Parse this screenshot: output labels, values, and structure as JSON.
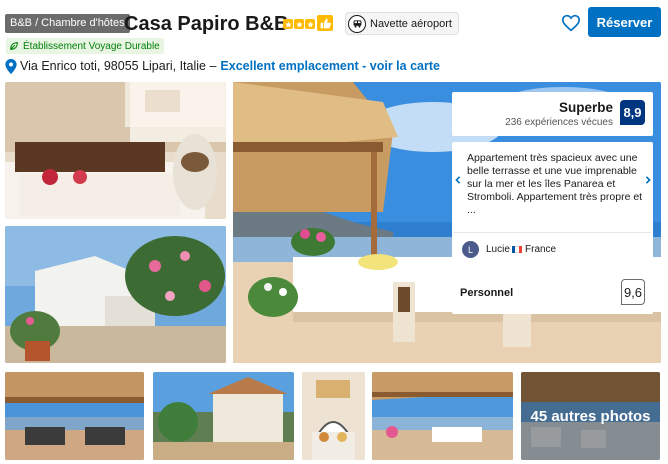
{
  "header": {
    "property_type": "B&B / Chambre d'hôtes",
    "title": "Casa Papiro B&B",
    "stars": 3,
    "shuttle_label": "Navette aéroport",
    "reserve_label": "Réserver"
  },
  "eco_label": "Établissement Voyage Durable",
  "address": {
    "text": "Via Enrico toti, 98055 Lipari, Italie –",
    "map_link": "Excellent emplacement - voir la carte"
  },
  "score": {
    "label": "Superbe",
    "count": "236 expériences vécues",
    "value": "8,9"
  },
  "review": {
    "text": "Appartement très spacieux avec une belle terrasse et une vue imprenable sur la mer et les îles Panarea et Stromboli. Appartement très propre et ...",
    "avatar_initial": "L",
    "name": "Lucie",
    "country": "France"
  },
  "staff": {
    "label": "Personnel",
    "score": "9,6"
  },
  "more_photos": "45 autres photos",
  "colors": {
    "brand_blue": "#0071c2",
    "dark_blue": "#003580",
    "star_yellow": "#febb02",
    "eco_green": "#008009"
  }
}
